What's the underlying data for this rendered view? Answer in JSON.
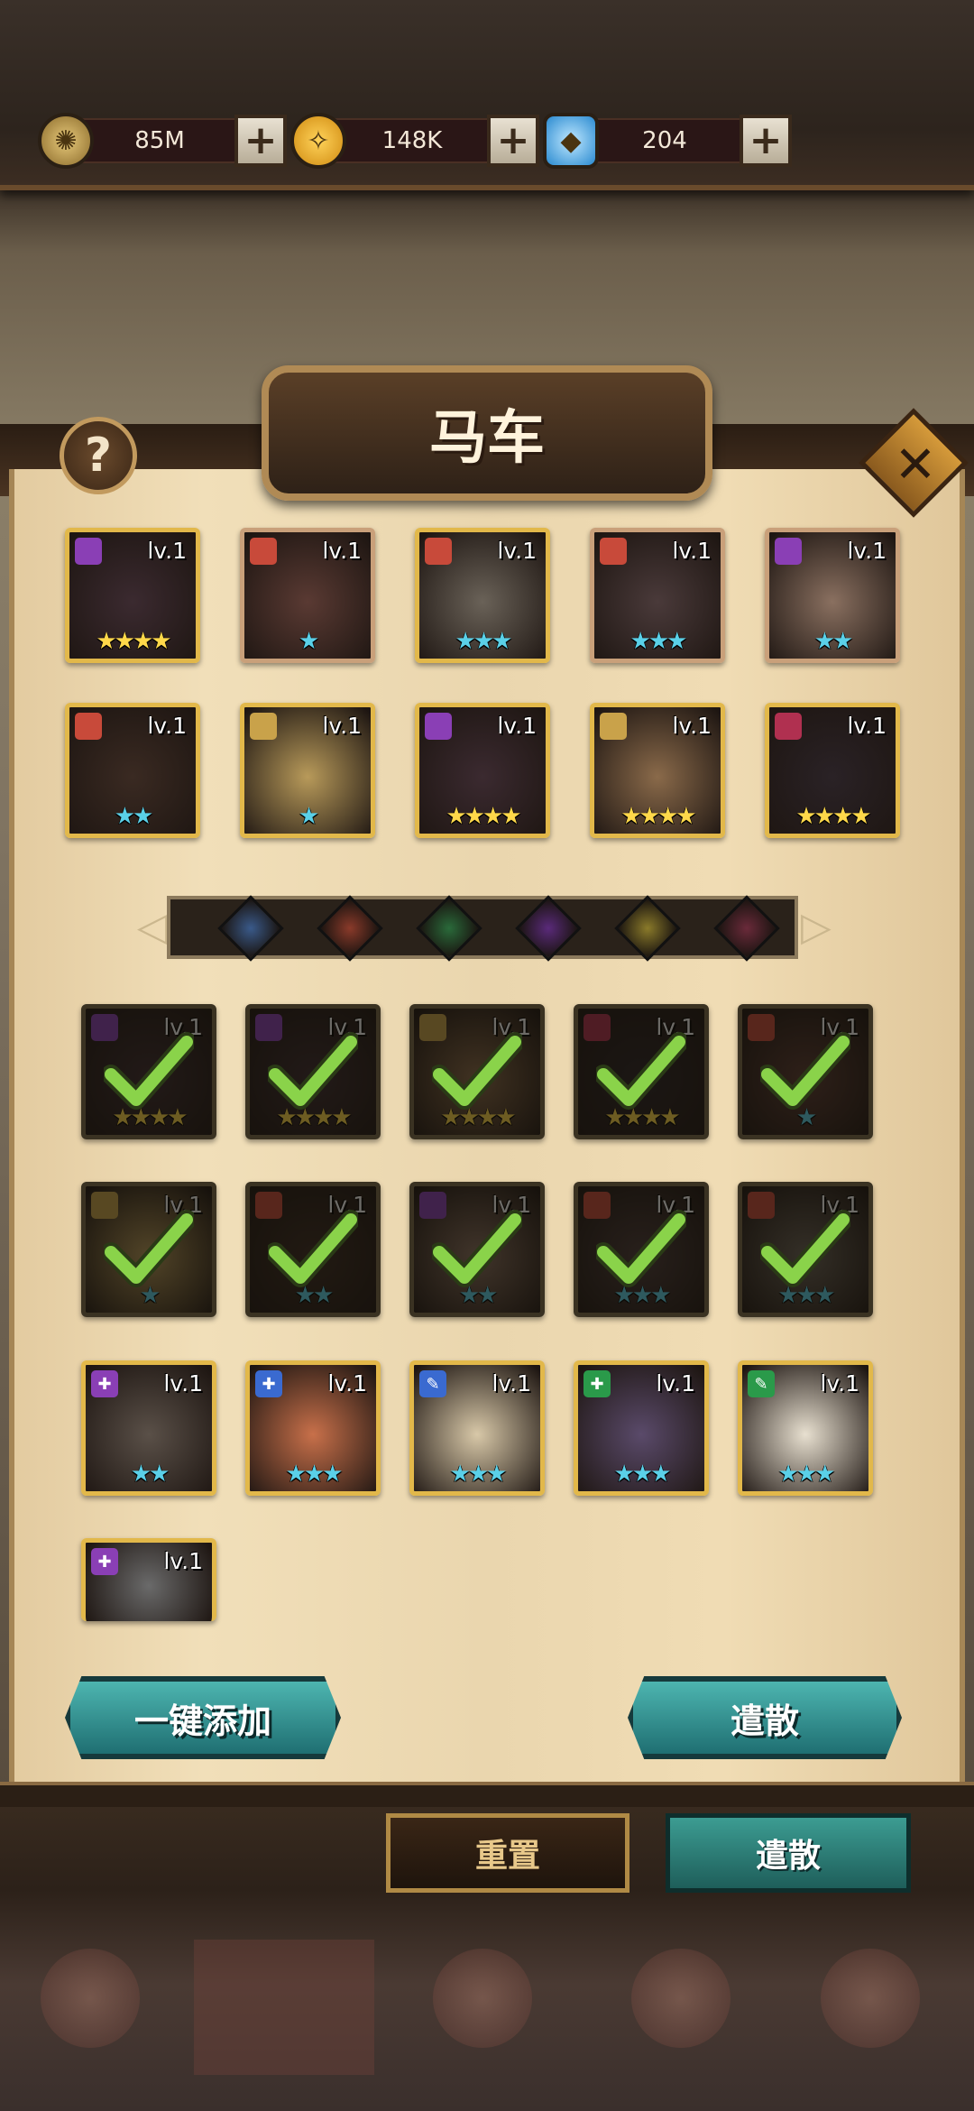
{
  "resources": [
    {
      "name": "gold",
      "value": "85M",
      "icon": "gold-coin-icon",
      "color": "#c9a24a"
    },
    {
      "name": "soul",
      "value": "148K",
      "icon": "soul-orb-icon",
      "color": "#f0b12a"
    },
    {
      "name": "diamond",
      "value": "204",
      "icon": "diamond-icon",
      "color": "#5ab8f0"
    }
  ],
  "plus_label": "+",
  "panel": {
    "title": "马车",
    "help_label": "?",
    "close_label": "✕"
  },
  "top_heroes": [
    {
      "level": "lv.1",
      "stars": "★★★★",
      "star_color": "#ffd84a",
      "elem": "#8a3fb5",
      "bg": "#3b2a30",
      "border": "#e2b84a"
    },
    {
      "level": "lv.1",
      "stars": "★",
      "star_color": "#5ad0e8",
      "elem": "#c84a3a",
      "bg": "#5a3a33",
      "border": "#c9a07a"
    },
    {
      "level": "lv.1",
      "stars": "★★★",
      "star_color": "#5ad0e8",
      "elem": "#c84a3a",
      "bg": "#6a6258",
      "border": "#e2b84a"
    },
    {
      "level": "lv.1",
      "stars": "★★★",
      "star_color": "#5ad0e8",
      "elem": "#c84a3a",
      "bg": "#4a3a3a",
      "border": "#c9a07a"
    },
    {
      "level": "lv.1",
      "stars": "★★",
      "star_color": "#5ad0e8",
      "elem": "#8a3fb5",
      "bg": "#8a7060",
      "border": "#c9a07a"
    },
    {
      "level": "lv.1",
      "stars": "★★",
      "star_color": "#5ad0e8",
      "elem": "#c84a3a",
      "bg": "#3a2a22",
      "border": "#e2b84a"
    },
    {
      "level": "lv.1",
      "stars": "★",
      "star_color": "#5ad0e8",
      "elem": "#c9a24a",
      "bg": "#b89a5a",
      "border": "#e2b84a"
    },
    {
      "level": "lv.1",
      "stars": "★★★★",
      "star_color": "#ffd84a",
      "elem": "#8a3fb5",
      "bg": "#3b2a30",
      "border": "#e2b84a"
    },
    {
      "level": "lv.1",
      "stars": "★★★★",
      "star_color": "#ffd84a",
      "elem": "#c9a24a",
      "bg": "#8a6a4a",
      "border": "#e2b84a"
    },
    {
      "level": "lv.1",
      "stars": "★★★★",
      "star_color": "#ffd84a",
      "elem": "#b03050",
      "bg": "#2a2226",
      "border": "#e2b84a"
    }
  ],
  "filter_icons": [
    {
      "name": "filter-all-icon",
      "color": "#3a5a8a"
    },
    {
      "name": "filter-fire-icon",
      "color": "#8a3a2a"
    },
    {
      "name": "filter-nature-icon",
      "color": "#2a6a3a"
    },
    {
      "name": "filter-shadow-icon",
      "color": "#5a2a7a"
    },
    {
      "name": "filter-light-icon",
      "color": "#8a7a2a"
    },
    {
      "name": "filter-chaos-icon",
      "color": "#6a2a3a"
    }
  ],
  "selected_heroes": [
    {
      "level": "lv.1",
      "stars": "★★★★",
      "star_color": "#ffd84a",
      "elem": "#8a3fb5",
      "bg": "#3b2a30"
    },
    {
      "level": "lv.1",
      "stars": "★★★★",
      "star_color": "#ffd84a",
      "elem": "#8a3fb5",
      "bg": "#3b2a30"
    },
    {
      "level": "lv.1",
      "stars": "★★★★",
      "star_color": "#ffd84a",
      "elem": "#c9a24a",
      "bg": "#8a6a4a"
    },
    {
      "level": "lv.1",
      "stars": "★★★★",
      "star_color": "#ffd84a",
      "elem": "#b03050",
      "bg": "#2a2226"
    },
    {
      "level": "lv.1",
      "stars": "★",
      "star_color": "#5ad0e8",
      "elem": "#c84a3a",
      "bg": "#5a3a33"
    },
    {
      "level": "lv.1",
      "stars": "★",
      "star_color": "#5ad0e8",
      "elem": "#c9a24a",
      "bg": "#b89a5a"
    },
    {
      "level": "lv.1",
      "stars": "★★",
      "star_color": "#5ad0e8",
      "elem": "#c84a3a",
      "bg": "#3a2a22"
    },
    {
      "level": "lv.1",
      "stars": "★★",
      "star_color": "#5ad0e8",
      "elem": "#8a3fb5",
      "bg": "#8a7060"
    },
    {
      "level": "lv.1",
      "stars": "★★★",
      "star_color": "#5ad0e8",
      "elem": "#c84a3a",
      "bg": "#4a3a3a"
    },
    {
      "level": "lv.1",
      "stars": "★★★",
      "star_color": "#5ad0e8",
      "elem": "#c84a3a",
      "bg": "#6a6258"
    }
  ],
  "other_heroes": [
    {
      "level": "lv.1",
      "stars": "★★",
      "star_color": "#5ad0e8",
      "elem": "#8a3fb5",
      "elem_glyph": "✚",
      "bg": "#5a5048"
    },
    {
      "level": "lv.1",
      "stars": "★★★",
      "star_color": "#5ad0e8",
      "elem": "#3a6ad0",
      "elem_glyph": "✚",
      "bg": "#c8704a"
    },
    {
      "level": "lv.1",
      "stars": "★★★",
      "star_color": "#5ad0e8",
      "elem": "#3a6ad0",
      "elem_glyph": "✎",
      "bg": "#d8c8a8"
    },
    {
      "level": "lv.1",
      "stars": "★★★",
      "star_color": "#5ad0e8",
      "elem": "#2a9a4a",
      "elem_glyph": "✚",
      "bg": "#5a4a6a"
    },
    {
      "level": "lv.1",
      "stars": "★★★",
      "star_color": "#5ad0e8",
      "elem": "#2a9a4a",
      "elem_glyph": "✎",
      "bg": "#e8e0d0"
    },
    {
      "level": "lv.1",
      "stars": "",
      "star_color": "#5ad0e8",
      "elem": "#8a3fb5",
      "elem_glyph": "✚",
      "bg": "#6a6a6a"
    }
  ],
  "buttons": {
    "auto_add": "一键添加",
    "dismiss": "遣散",
    "reset": "重置",
    "dismiss_tab": "遣散"
  }
}
